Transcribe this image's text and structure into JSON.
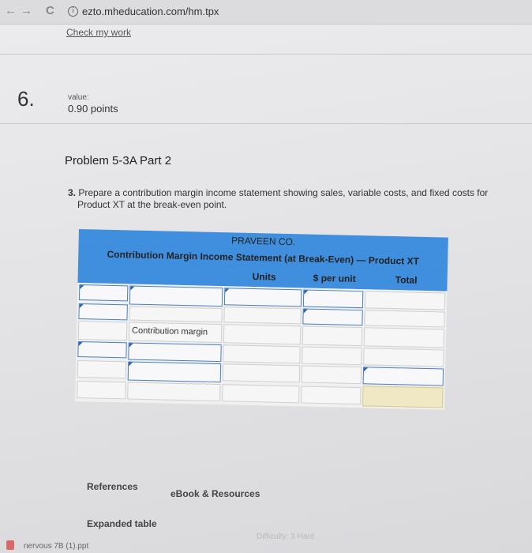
{
  "browser": {
    "url": "ezto.mheducation.com/hm.tpx",
    "back_glyph": "←",
    "forward_glyph": "→",
    "reload_glyph": "C",
    "info_glyph": "i"
  },
  "check_my_work": "Check my work",
  "question": {
    "number": "6.",
    "value_label": "value:",
    "points": "0.90 points"
  },
  "problem": {
    "title": "Problem 5-3A Part 2",
    "instruction_number": "3.",
    "instruction_line1": "Prepare a contribution margin income statement showing sales, variable costs, and fixed costs for",
    "instruction_line2": "Product XT at the break-even point."
  },
  "worksheet": {
    "company": "PRAVEEN CO.",
    "statement_title": "Contribution Margin Income Statement (at Break-Even) — Product XT",
    "columns": [
      "Units",
      "$ per unit",
      "Total"
    ],
    "contribution_margin_label": "Contribution margin"
  },
  "links": {
    "references": "References",
    "ebook": "eBook & Resources",
    "expanded_table": "Expanded table"
  },
  "difficulty": "Difficulty: 3 Hard",
  "bottom_file": "nervous 7B (1).ppt",
  "colors": {
    "header_blue": "#3f8fde",
    "input_border": "#4a7fc0",
    "total_cell": "#f0e7c4"
  }
}
